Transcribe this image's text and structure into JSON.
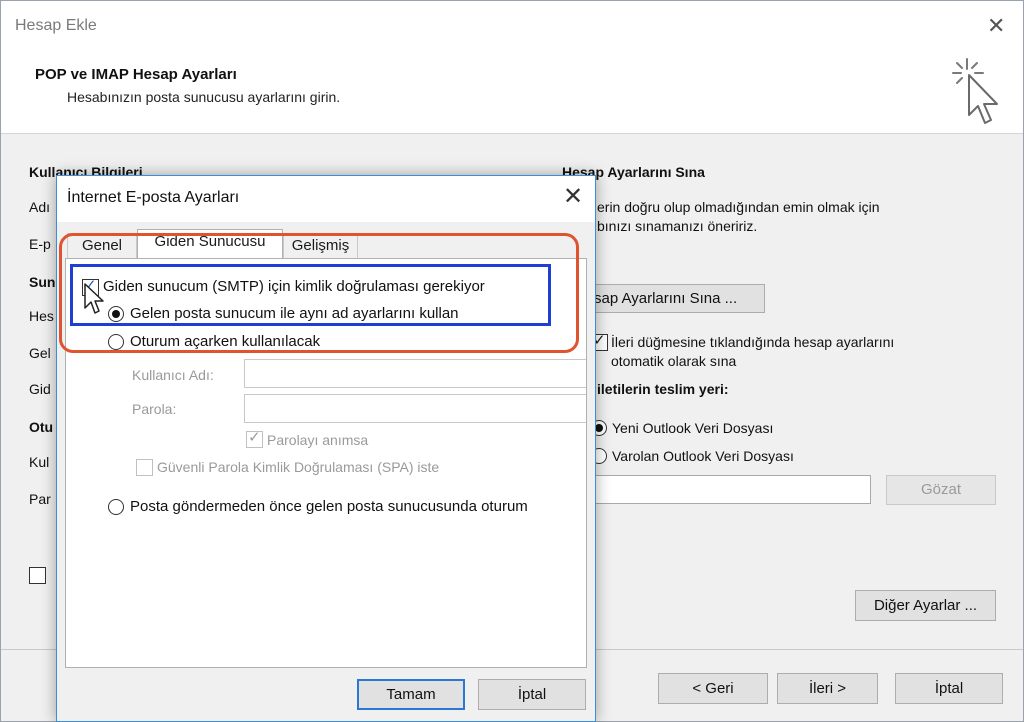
{
  "outer": {
    "title": "Hesap Ekle",
    "heading": "POP ve IMAP Hesap Ayarları",
    "subheading": "Hesabınızın posta sunucusu ayarlarını girin.",
    "left_section_partial": {
      "user_info": "Kullanıcı Bilgileri",
      "name": "Adı",
      "email": "E-p",
      "server": "Sun",
      "account_type": "Hes",
      "incoming": "Gel",
      "outgoing": "Gid",
      "logon": "Otu",
      "username": "Kul",
      "password": "Par"
    },
    "test_section": {
      "title": "Hesap Ayarlarını Sına",
      "desc_line1": "erin doğru olup olmadığından emin olmak için",
      "desc_line2": "bınızı sınamanızı öneririz.",
      "test_button": "sap Ayarlarını Sına ...",
      "auto_test_line1": "İleri düğmesine tıklandığında hesap ayarlarını",
      "auto_test_line2": "otomatik olarak sına",
      "delivery_label": "iletilerin teslim yeri:",
      "new_data_file": "Yeni Outlook Veri Dosyası",
      "existing_data_file": "Varolan Outlook Veri Dosyası",
      "browse_button": "Gözat",
      "more_settings_button": "Diğer Ayarlar ..."
    },
    "buttons": {
      "back": "< Geri",
      "next": "İleri >",
      "cancel": "İptal"
    }
  },
  "dialog": {
    "title": "İnternet E-posta Ayarları",
    "tabs": [
      "Genel",
      "Giden Sunucusu",
      "Gelişmiş"
    ],
    "active_tab": "Giden Sunucusu",
    "smtp_auth_label": "Giden sunucum (SMTP) için kimlik doğrulaması gerekiyor",
    "smtp_auth_checked": true,
    "use_same_label": "Gelen posta sunucum ile aynı ad ayarlarını kullan",
    "logon_using_label": "Oturum açarken kullanılacak",
    "username_label": "Kullanıcı Adı:",
    "password_label": "Parola:",
    "remember_password_label": "Parolayı anımsa",
    "spa_label": "Güvenli Parola Kimlik Doğrulaması (SPA) iste",
    "logon_before_label": "Posta göndermeden önce gelen posta sunucusunda oturum",
    "ok_button": "Tamam",
    "cancel_button": "İptal"
  },
  "annotation_colors": {
    "red_outline": "#e0532f",
    "blue_outline": "#1e3fd1"
  }
}
